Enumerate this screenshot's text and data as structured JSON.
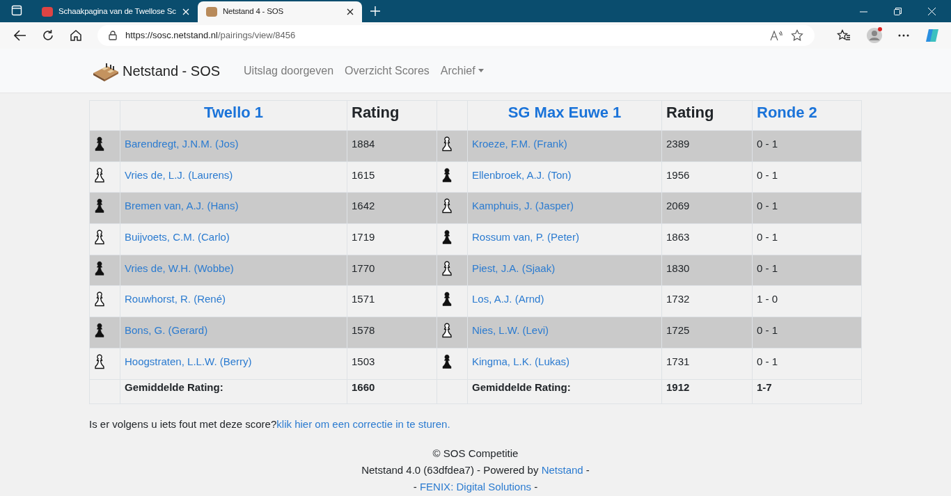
{
  "browser": {
    "tabs": [
      {
        "title": "Schaakpagina van de Twellose Sc",
        "selected": false
      },
      {
        "title": "Netstand 4 - SOS",
        "selected": true
      }
    ],
    "url_host": "https://sosc.netstand.nl",
    "url_path": "/pairings/view/8456"
  },
  "navbar": {
    "brand": "Netstand - SOS",
    "links": [
      "Uitslag doorgeven",
      "Overzicht Scores"
    ],
    "dropdown": "Archief"
  },
  "table": {
    "home_team": "Twello 1",
    "away_team": "SG Max Euwe 1",
    "home_rating_header": "Rating",
    "away_rating_header": "Rating",
    "round": "Ronde 2",
    "rows": [
      {
        "home_black": true,
        "home": "Barendregt, J.N.M. (Jos)",
        "home_rating": "1884",
        "away_black": false,
        "away": "Kroeze, F.M. (Frank)",
        "away_rating": "2389",
        "result": "0 - 1"
      },
      {
        "home_black": false,
        "home": "Vries de, L.J. (Laurens)",
        "home_rating": "1615",
        "away_black": true,
        "away": "Ellenbroek, A.J. (Ton)",
        "away_rating": "1956",
        "result": "0 - 1"
      },
      {
        "home_black": true,
        "home": "Bremen van, A.J. (Hans)",
        "home_rating": "1642",
        "away_black": false,
        "away": "Kamphuis, J. (Jasper)",
        "away_rating": "2069",
        "result": "0 - 1"
      },
      {
        "home_black": false,
        "home": "Buijvoets, C.M. (Carlo)",
        "home_rating": "1719",
        "away_black": true,
        "away": "Rossum van, P. (Peter)",
        "away_rating": "1863",
        "result": "0 - 1"
      },
      {
        "home_black": true,
        "home": "Vries de, W.H. (Wobbe)",
        "home_rating": "1770",
        "away_black": false,
        "away": "Piest, J.A. (Sjaak)",
        "away_rating": "1830",
        "result": "0 - 1"
      },
      {
        "home_black": false,
        "home": "Rouwhorst, R. (René)",
        "home_rating": "1571",
        "away_black": true,
        "away": "Los, A.J. (Arnd)",
        "away_rating": "1732",
        "result": "1 - 0"
      },
      {
        "home_black": true,
        "home": "Bons, G. (Gerard)",
        "home_rating": "1578",
        "away_black": false,
        "away": "Nies, L.W. (Levi)",
        "away_rating": "1725",
        "result": "0 - 1"
      },
      {
        "home_black": false,
        "home": "Hoogstraten, L.L.W. (Berry)",
        "home_rating": "1503",
        "away_black": true,
        "away": "Kingma, L.K. (Lukas)",
        "away_rating": "1731",
        "result": "0 - 1"
      }
    ],
    "footer_row": {
      "home_label": "Gemiddelde Rating:",
      "home_avg": "1660",
      "away_label": "Gemiddelde Rating:",
      "away_avg": "1912",
      "total": "1-7"
    }
  },
  "correction": {
    "text": "Is er volgens u iets fout met deze score?",
    "link": "klik hier om een correctie in te sturen."
  },
  "footer": {
    "copyright": "© SOS Competitie",
    "version": "Netstand 4.0 (63dfdea7) - Powered by ",
    "version_link": "Netstand",
    "version_end": " -",
    "line3_start": "- ",
    "line3_link": "FENIX: Digital Solutions",
    "line3_end": " -"
  }
}
